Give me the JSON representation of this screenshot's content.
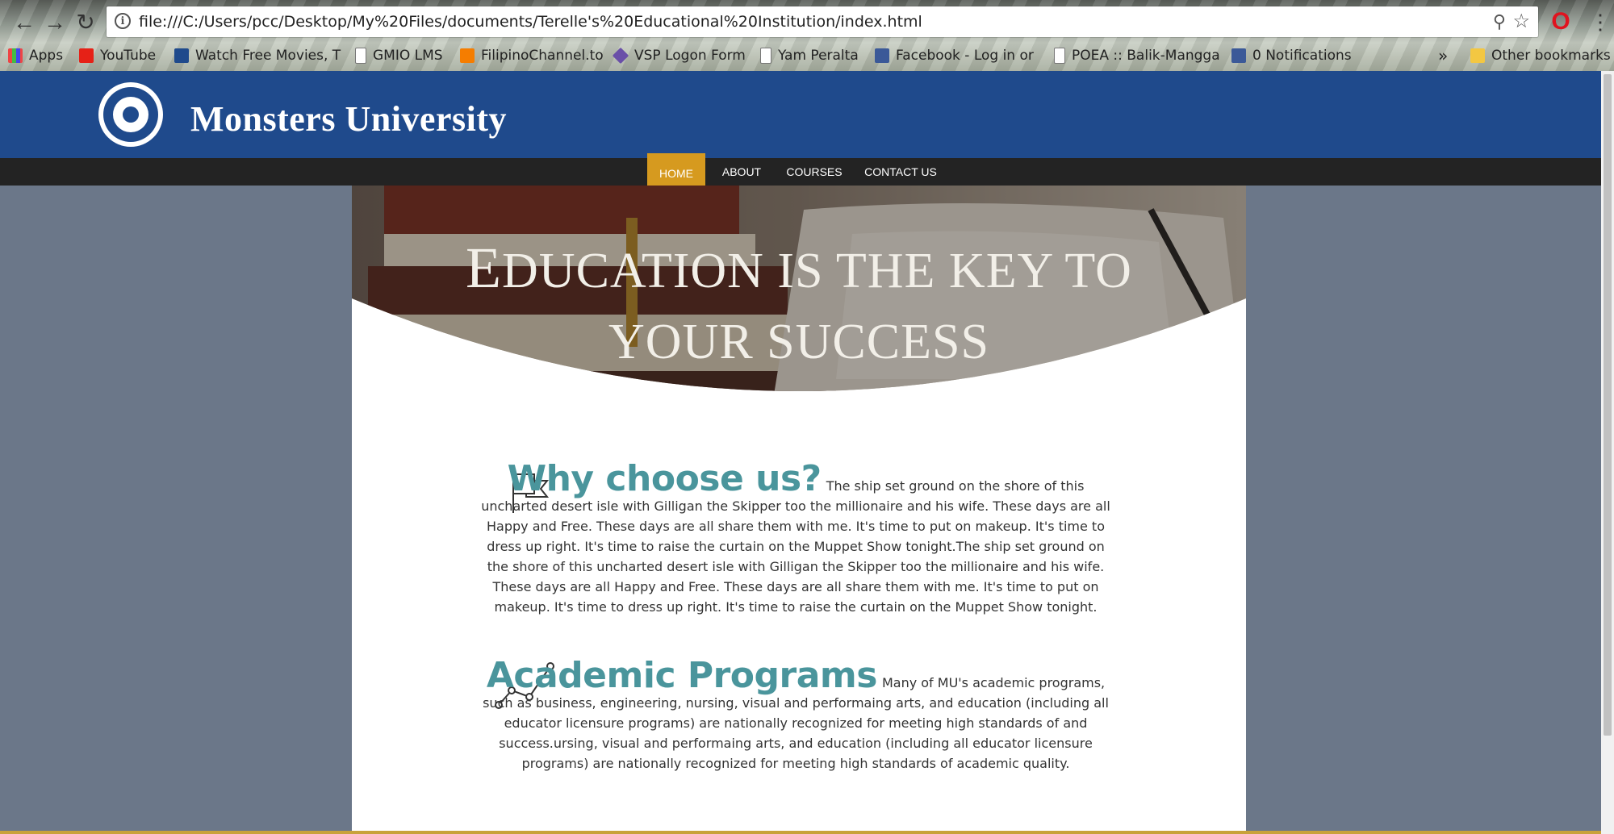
{
  "browser": {
    "url": "file:///C:/Users/pcc/Desktop/My%20Files/documents/Terelle's%20Educational%20Institution/index.html",
    "bookmarks": [
      {
        "label": "Apps",
        "icon": "apps-grid-icon"
      },
      {
        "label": "YouTube",
        "icon": "youtube-icon"
      },
      {
        "label": "Watch Free Movies, T",
        "icon": "movies-icon"
      },
      {
        "label": "GMIO LMS",
        "icon": "page-icon"
      },
      {
        "label": "FilipinoChannel.to",
        "icon": "blogger-icon"
      },
      {
        "label": "VSP Logon Form",
        "icon": "vsp-icon"
      },
      {
        "label": "Yam Peralta",
        "icon": "page-icon"
      },
      {
        "label": "Facebook - Log in or",
        "icon": "facebook-icon"
      },
      {
        "label": "POEA :: Balik-Mangga",
        "icon": "page-icon"
      },
      {
        "label": "0 Notifications",
        "icon": "facebook-icon"
      }
    ],
    "overflow": "»",
    "other_bookmarks": "Other bookmarks"
  },
  "site": {
    "title": "Monsters University",
    "logo_text": "MONSTERS UNIVERSITY"
  },
  "nav": {
    "items": [
      "HOME",
      "ABOUT",
      "COURSES",
      "CONTACT US"
    ],
    "active": "HOME"
  },
  "hero": {
    "first_letter": "E",
    "line1_rest": "DUCATION IS THE KEY TO",
    "line2": "YOUR SUCCESS"
  },
  "sections": [
    {
      "heading": "Why choose us?",
      "icon": "flag-icon",
      "body": "The ship set ground on the shore of this uncharted desert isle with Gilligan the Skipper too the millionaire and his wife. These days are all Happy and Free. These days are all share them with me. It's time to put on makeup. It's time to dress up right. It's time to raise the curtain on the Muppet Show tonight.The ship set ground on the shore of this uncharted desert isle with Gilligan the Skipper too the millionaire and his wife. These days are all Happy and Free. These days are all share them with me. It's time to put on makeup. It's time to dress up right. It's time to raise the curtain on the Muppet Show tonight."
    },
    {
      "heading": "Academic Programs",
      "icon": "line-chart-icon",
      "body": "Many of MU's academic programs, such as business, engineering, nursing, visual and performaing arts, and education (including all educator licensure programs) are nationally recognized for meeting high standards of and success.ursing, visual and performaing arts, and education (including all educator licensure programs) are nationally recognized for meeting high standards of academic quality."
    }
  ],
  "colors": {
    "header_blue": "#1f4a8c",
    "nav_dark": "#232323",
    "active_gold": "#d69a1f",
    "heading_teal": "#4a959c",
    "page_bg": "#6b7789"
  }
}
